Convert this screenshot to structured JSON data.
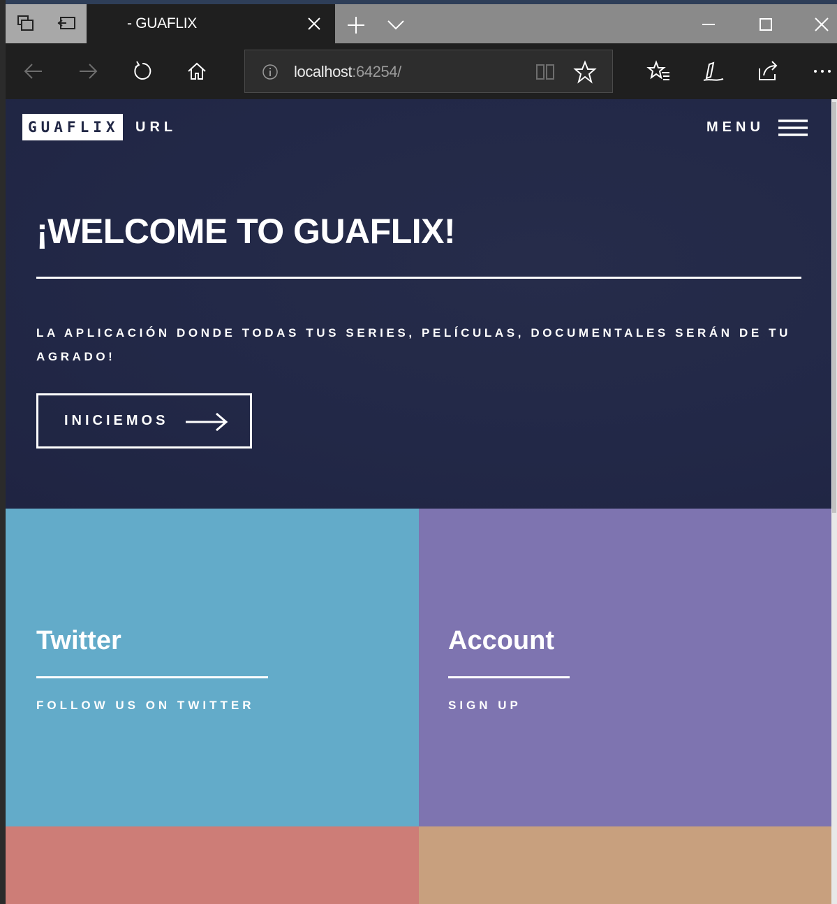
{
  "browser": {
    "tab_title": "- GUAFLIX",
    "address_host": "localhost",
    "address_port": ":64254/",
    "icons": {
      "tab_actions": [
        "set-aside-tabs-icon",
        "tab-preview-icon"
      ],
      "navigation": [
        "back-arrow-icon",
        "forward-arrow-icon",
        "refresh-icon",
        "home-icon"
      ],
      "address": [
        "info-icon",
        "reading-view-icon",
        "favorite-star-icon"
      ],
      "toolbar": [
        "favorites-hub-icon",
        "web-notes-icon",
        "share-icon",
        "more-icon"
      ],
      "window": [
        "minimize-icon",
        "maximize-icon",
        "close-icon"
      ]
    }
  },
  "header": {
    "logo": "GUAFLIX",
    "url_link": "URL",
    "menu_label": "MENU"
  },
  "hero": {
    "title": "¡WELCOME TO GUAFLIX!",
    "subtitle": "LA APLICACIÓN DONDE TODAS TUS SERIES, PELÍCULAS, DOCUMENTALES SERÁN DE TU AGRADO!",
    "cta_label": "INICIEMOS"
  },
  "tiles": [
    {
      "title": "Twitter",
      "link": "FOLLOW US ON TWITTER",
      "color": "#63abc9"
    },
    {
      "title": "Account",
      "link": "SIGN UP",
      "color": "#7e74b0"
    },
    {
      "color": "#cd7d77"
    },
    {
      "color": "#c8a07e"
    }
  ],
  "colors": {
    "hero_background": "#222847",
    "browser_chrome": "#1f1f1f"
  }
}
